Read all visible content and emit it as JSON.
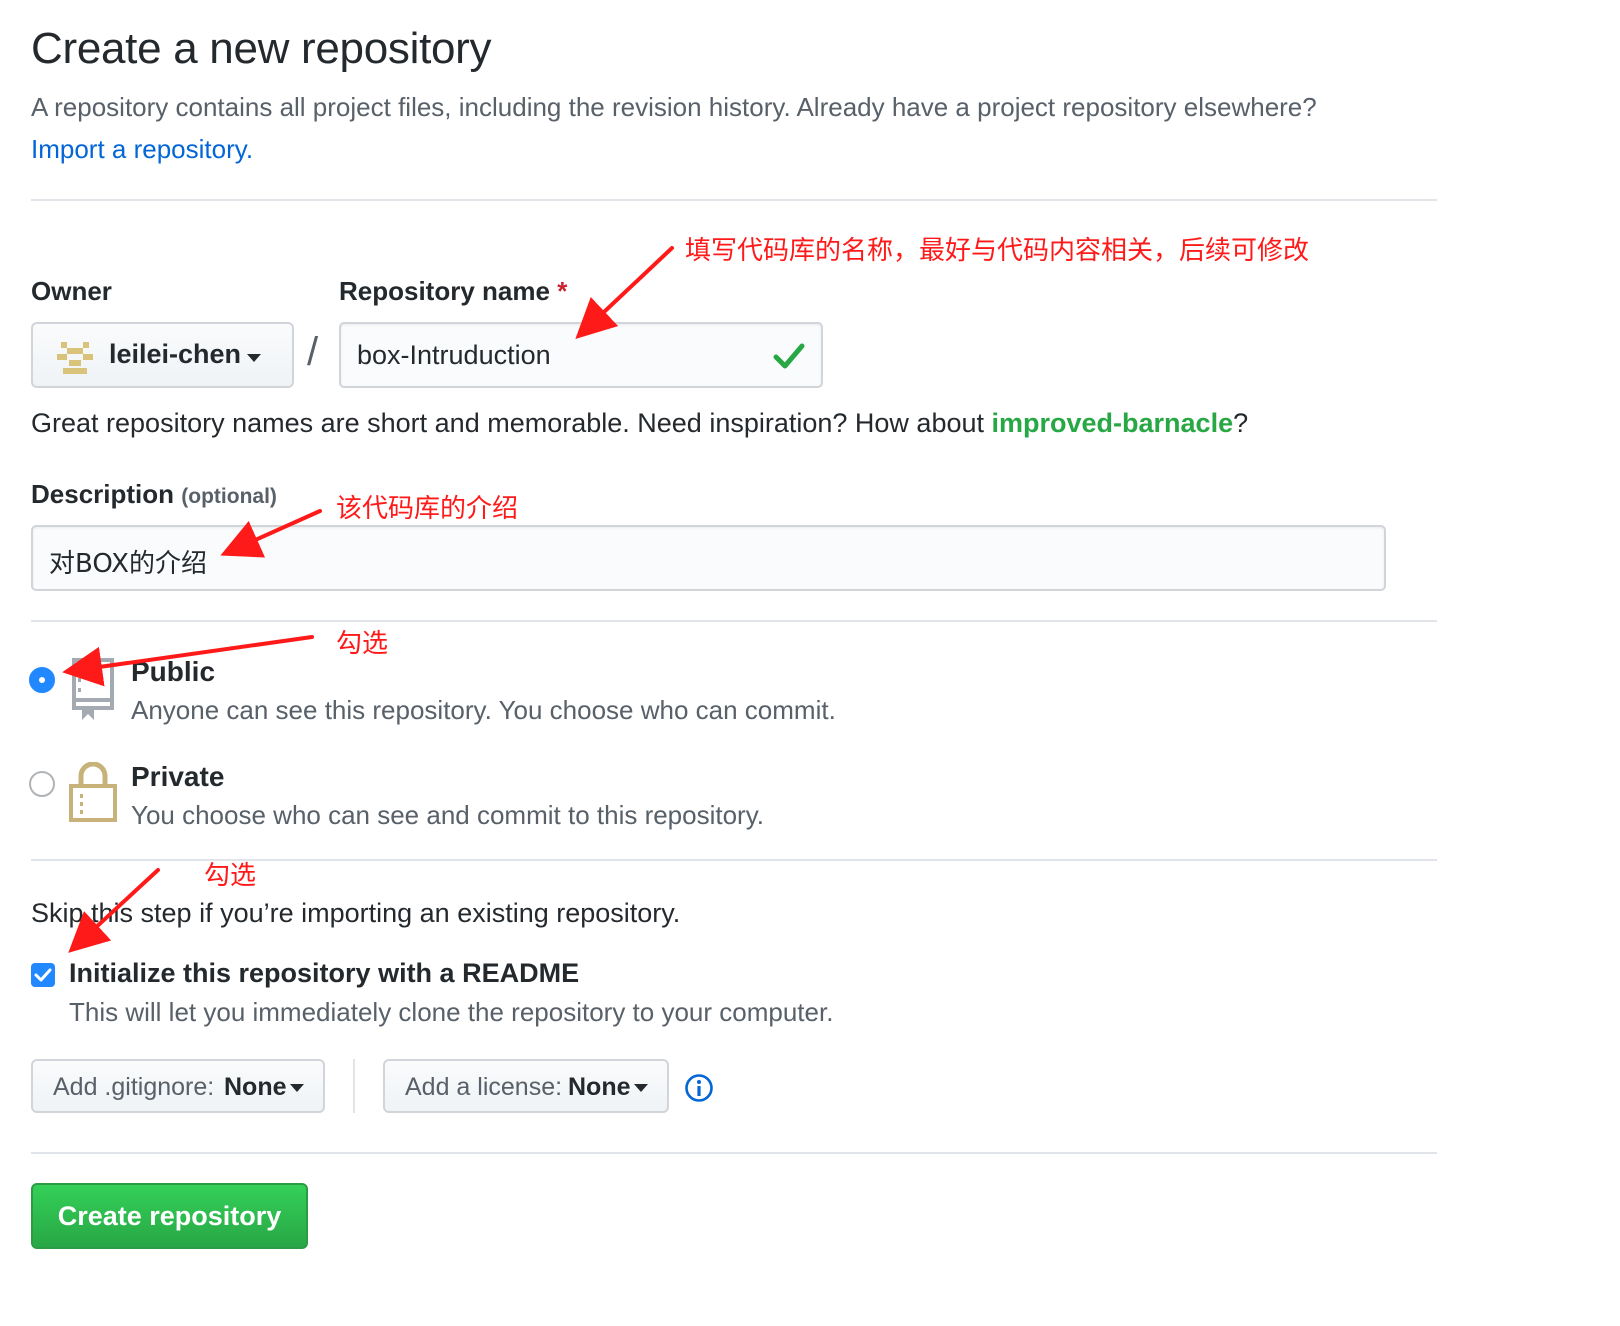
{
  "page": {
    "title": "Create a new repository",
    "subhead_text": "A repository contains all project files, including the revision history. Already have a project repository elsewhere?",
    "import_link": "Import a repository."
  },
  "owner": {
    "label": "Owner",
    "value": "leilei-chen"
  },
  "repo_name": {
    "label": "Repository name",
    "required_mark": "*",
    "value": "box-Intruduction"
  },
  "separator": "/",
  "name_hint": {
    "before": "Great repository names are short and memorable. Need inspiration? How about",
    "suggestion": "improved-barnacle",
    "after": "?"
  },
  "description": {
    "label": "Description",
    "optional": "(optional)",
    "value": "对BOX的介绍"
  },
  "visibility": {
    "public": {
      "title": "Public",
      "note": "Anyone can see this repository. You choose who can commit.",
      "selected": true
    },
    "private": {
      "title": "Private",
      "note": "You choose who can see and commit to this repository.",
      "selected": false
    }
  },
  "init": {
    "skip_note": "Skip this step if you’re importing an existing repository.",
    "readme_label": "Initialize this repository with a README",
    "readme_note": "This will let you immediately clone the repository to your computer.",
    "readme_checked": true
  },
  "gitignore": {
    "label": "Add .gitignore:",
    "value": "None"
  },
  "license": {
    "label": "Add a license:",
    "value": "None"
  },
  "submit": {
    "label": "Create repository"
  },
  "annotations": {
    "repo_name": "填写代码库的名称，最好与代码内容相关，后续可修改",
    "description": "该代码库的介绍",
    "public": "勾选",
    "readme": "勾选"
  },
  "colors": {
    "link": "#0366d6",
    "suggestion": "#28a745",
    "primary": "#28a745",
    "annotation": "#ff1a1a",
    "accent": "#2188ff"
  }
}
